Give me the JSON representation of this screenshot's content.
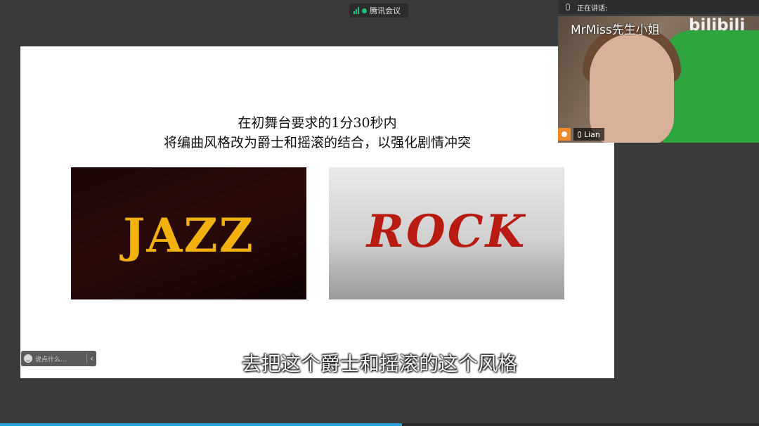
{
  "app": {
    "title": "腾讯会议"
  },
  "speaker_bar": {
    "label": "正在讲话:"
  },
  "video": {
    "watermark": "MrMiss先生小姐",
    "logo": "bilibili",
    "participant": "Lian"
  },
  "slide": {
    "title_line1": "在初舞台要求的1分30秒内",
    "title_line2": "将编曲风格改为爵士和摇滚的结合，以强化剧情冲突",
    "jazz_label": "JAZZ",
    "rock_label": "ROCK"
  },
  "subtitle": "去把这个爵士和摇滚的这个风格",
  "chat": {
    "placeholder": "说点什么..."
  },
  "progress": {
    "fraction": 0.53
  },
  "colors": {
    "jazz": "#f2b10f",
    "rock": "#b81b12",
    "accent": "#21c27b",
    "progress": "#2a9bd6"
  }
}
